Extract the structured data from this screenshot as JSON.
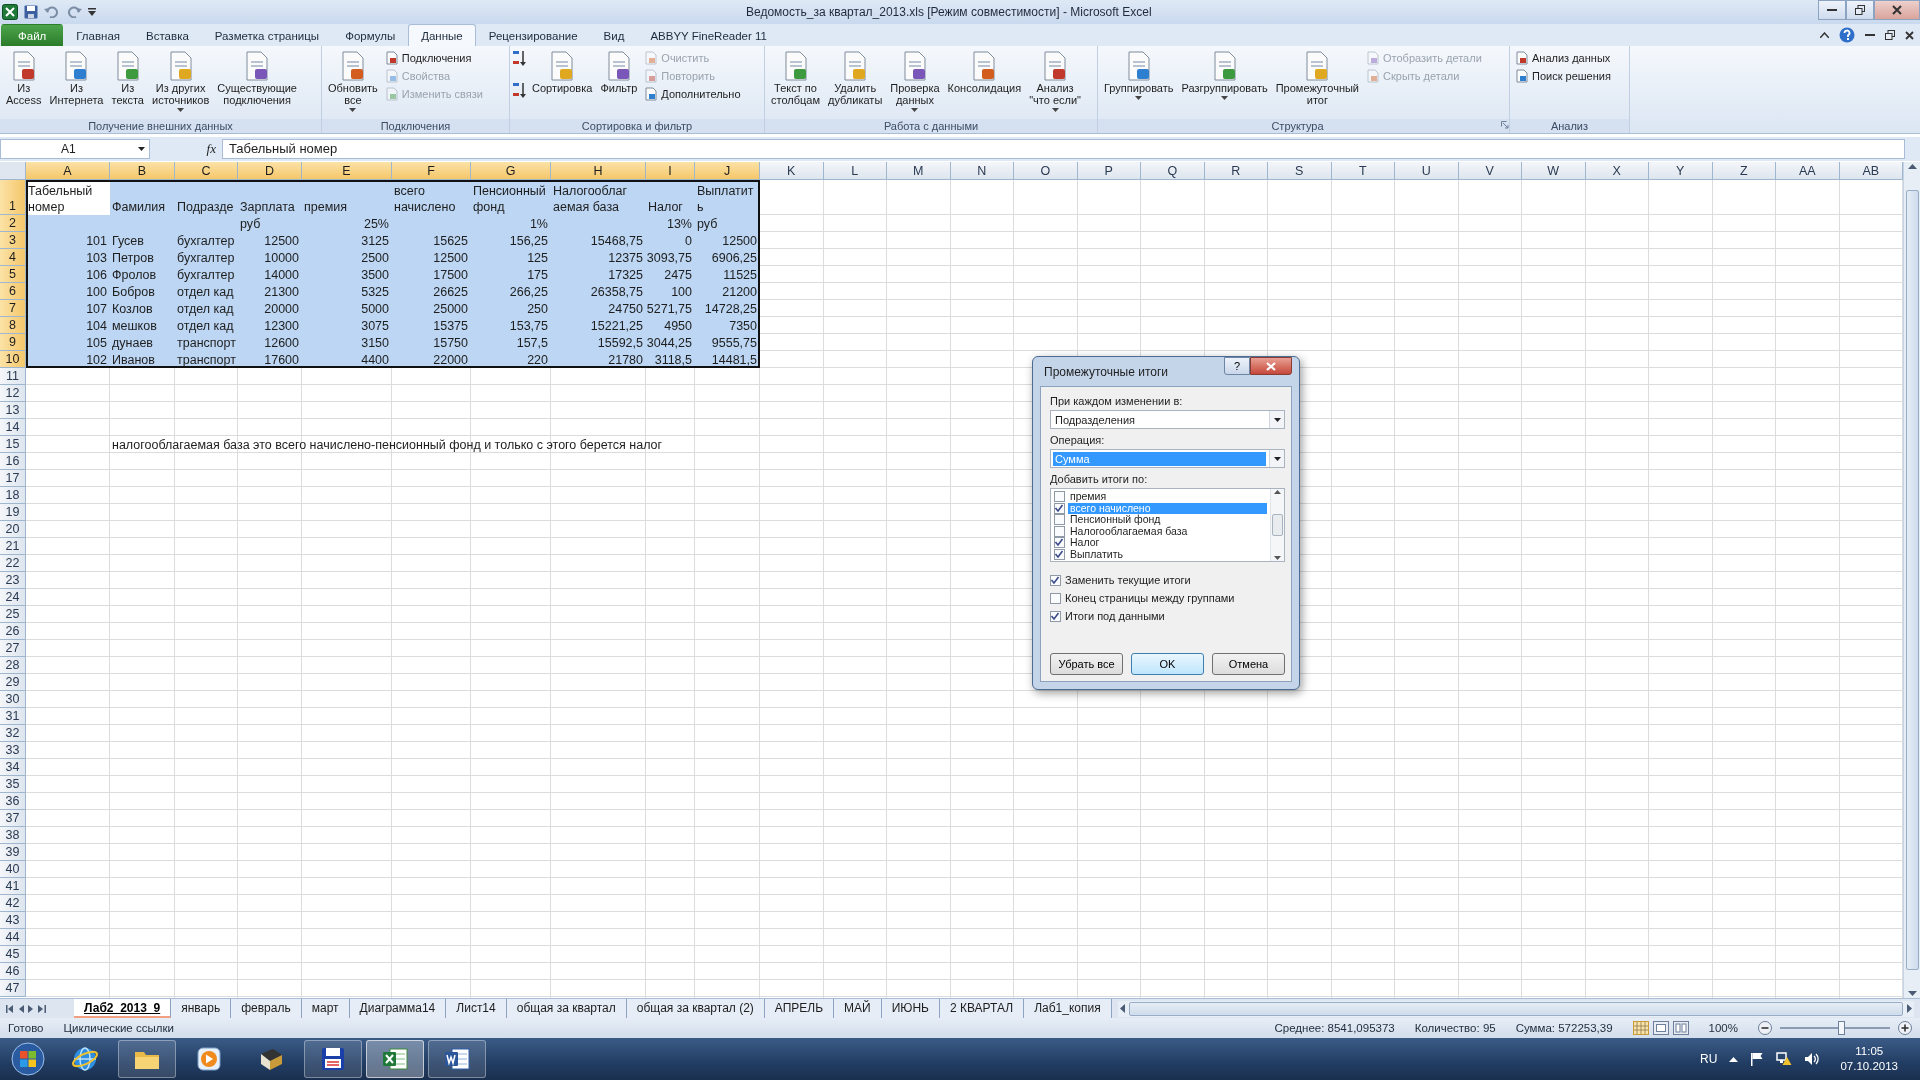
{
  "window": {
    "title": "Ведомость_за квартал_2013.xls  [Режим совместимости]  -  Microsoft Excel"
  },
  "ribbon_tabs": [
    {
      "label": "Файл",
      "kind": "file",
      "selected": false
    },
    {
      "label": "Главная",
      "kind": "tab",
      "selected": false
    },
    {
      "label": "Вставка",
      "kind": "tab",
      "selected": false
    },
    {
      "label": "Разметка страницы",
      "kind": "tab",
      "selected": false
    },
    {
      "label": "Формулы",
      "kind": "tab",
      "selected": false
    },
    {
      "label": "Данные",
      "kind": "tab",
      "selected": true
    },
    {
      "label": "Рецензирование",
      "kind": "tab",
      "selected": false
    },
    {
      "label": "Вид",
      "kind": "tab",
      "selected": false
    },
    {
      "label": "ABBYY FineReader 11",
      "kind": "tab",
      "selected": false
    }
  ],
  "ribbon_groups": [
    {
      "label": "Получение внешних данных",
      "launcher": false,
      "buttons": [
        {
          "kind": "large",
          "label": "Из\nAccess",
          "dropdown": false,
          "disabled": false
        },
        {
          "kind": "large",
          "label": "Из\nИнтернета",
          "dropdown": false,
          "disabled": false
        },
        {
          "kind": "large",
          "label": "Из\nтекста",
          "dropdown": false,
          "disabled": false
        },
        {
          "kind": "large",
          "label": "Из других\nисточников",
          "dropdown": true,
          "disabled": false
        },
        {
          "kind": "large",
          "label": "Существующие\nподключения",
          "dropdown": false,
          "disabled": false
        }
      ]
    },
    {
      "label": "Подключения",
      "launcher": false,
      "buttons": [
        {
          "kind": "large",
          "label": "Обновить\nвсе",
          "dropdown": true,
          "disabled": false
        },
        {
          "kind": "small",
          "label": "Подключения",
          "dropdown": false,
          "disabled": false
        },
        {
          "kind": "small",
          "label": "Свойства",
          "dropdown": false,
          "disabled": true
        },
        {
          "kind": "small",
          "label": "Изменить связи",
          "dropdown": false,
          "disabled": true
        }
      ]
    },
    {
      "label": "Сортировка и фильтр",
      "launcher": false,
      "buttons": [
        {
          "kind": "icon",
          "dropdown": false,
          "disabled": false
        },
        {
          "kind": "icon",
          "dropdown": false,
          "disabled": false
        },
        {
          "kind": "large",
          "label": "Сортировка",
          "dropdown": false,
          "disabled": false
        },
        {
          "kind": "large",
          "label": "Фильтр",
          "dropdown": false,
          "disabled": false
        },
        {
          "kind": "small",
          "label": "Очистить",
          "dropdown": false,
          "disabled": true
        },
        {
          "kind": "small",
          "label": "Повторить",
          "dropdown": false,
          "disabled": true
        },
        {
          "kind": "small",
          "label": "Дополнительно",
          "dropdown": false,
          "disabled": false
        }
      ]
    },
    {
      "label": "Работа с данными",
      "launcher": false,
      "buttons": [
        {
          "kind": "large",
          "label": "Текст по\nстолбцам",
          "dropdown": false,
          "disabled": false
        },
        {
          "kind": "large",
          "label": "Удалить\nдубликаты",
          "dropdown": false,
          "disabled": false
        },
        {
          "kind": "large",
          "label": "Проверка\nданных",
          "dropdown": true,
          "disabled": false
        },
        {
          "kind": "large",
          "label": "Консолидация",
          "dropdown": false,
          "disabled": false
        },
        {
          "kind": "large",
          "label": "Анализ\n\"что если\"",
          "dropdown": true,
          "disabled": false
        }
      ]
    },
    {
      "label": "Структура",
      "launcher": true,
      "buttons": [
        {
          "kind": "large",
          "label": "Группировать",
          "dropdown": true,
          "disabled": false
        },
        {
          "kind": "large",
          "label": "Разгруппировать",
          "dropdown": true,
          "disabled": false
        },
        {
          "kind": "large",
          "label": "Промежуточный\nитог",
          "dropdown": false,
          "disabled": false
        },
        {
          "kind": "small",
          "label": "Отобразить детали",
          "dropdown": false,
          "disabled": true
        },
        {
          "kind": "small",
          "label": "Скрыть детали",
          "dropdown": false,
          "disabled": true
        }
      ]
    },
    {
      "label": "Анализ",
      "launcher": false,
      "buttons": [
        {
          "kind": "small",
          "label": "Анализ данных",
          "dropdown": false,
          "disabled": false
        },
        {
          "kind": "small",
          "label": "Поиск решения",
          "dropdown": false,
          "disabled": false
        }
      ]
    }
  ],
  "formula_bar": {
    "name_box": "A1",
    "fx": "fx",
    "value": "Табельный номер"
  },
  "columns": [
    {
      "label": "A",
      "selected": true
    },
    {
      "label": "B",
      "selected": true
    },
    {
      "label": "C",
      "selected": true
    },
    {
      "label": "D",
      "selected": true
    },
    {
      "label": "E",
      "selected": true
    },
    {
      "label": "F",
      "selected": true
    },
    {
      "label": "G",
      "selected": true
    },
    {
      "label": "H",
      "selected": true
    },
    {
      "label": "I",
      "selected": true
    },
    {
      "label": "J",
      "selected": true
    },
    {
      "label": "K",
      "selected": false
    },
    {
      "label": "L",
      "selected": false
    },
    {
      "label": "M",
      "selected": false
    },
    {
      "label": "N",
      "selected": false
    },
    {
      "label": "O",
      "selected": false
    },
    {
      "label": "P",
      "selected": false
    },
    {
      "label": "Q",
      "selected": false
    },
    {
      "label": "R",
      "selected": false
    },
    {
      "label": "S",
      "selected": false
    },
    {
      "label": "T",
      "selected": false
    },
    {
      "label": "U",
      "selected": false
    },
    {
      "label": "V",
      "selected": false
    },
    {
      "label": "W",
      "selected": false
    },
    {
      "label": "X",
      "selected": false
    },
    {
      "label": "Y",
      "selected": false
    },
    {
      "label": "Z",
      "selected": false
    },
    {
      "label": "AA",
      "selected": false
    },
    {
      "label": "AB",
      "selected": false
    }
  ],
  "rows": [
    {
      "number": "1",
      "selected": true,
      "cells": [
        "Табельный номер",
        "Фамилия",
        "Подразде",
        "Зарплата",
        "премия",
        "всего начислено",
        "Пенсионный фонд",
        "Налогооблаг аемая база",
        "Налог",
        "Выплатить"
      ]
    },
    {
      "number": "2",
      "selected": true,
      "cells": [
        null,
        null,
        null,
        "руб",
        "25%",
        null,
        "1%",
        null,
        "13%",
        "руб"
      ]
    },
    {
      "number": "3",
      "selected": true,
      "cells": [
        "101",
        "Гусев",
        "бухгалтер",
        "12500",
        "3125",
        "15625",
        "156,25",
        "15468,75",
        "0",
        "12500"
      ]
    },
    {
      "number": "4",
      "selected": true,
      "cells": [
        "103",
        "Петров",
        "бухгалтер",
        "10000",
        "2500",
        "12500",
        "125",
        "12375",
        "3093,75",
        "6906,25"
      ]
    },
    {
      "number": "5",
      "selected": true,
      "cells": [
        "106",
        "Фролов",
        "бухгалтер",
        "14000",
        "3500",
        "17500",
        "175",
        "17325",
        "2475",
        "11525"
      ]
    },
    {
      "number": "6",
      "selected": true,
      "cells": [
        "100",
        "Бобров",
        "отдел кад",
        "21300",
        "5325",
        "26625",
        "266,25",
        "26358,75",
        "100",
        "21200"
      ]
    },
    {
      "number": "7",
      "selected": true,
      "cells": [
        "107",
        "Козлов",
        "отдел кад",
        "20000",
        "5000",
        "25000",
        "250",
        "24750",
        "5271,75",
        "14728,25"
      ]
    },
    {
      "number": "8",
      "selected": true,
      "cells": [
        "104",
        "мешков",
        "отдел кад",
        "12300",
        "3075",
        "15375",
        "153,75",
        "15221,25",
        "4950",
        "7350"
      ]
    },
    {
      "number": "9",
      "selected": true,
      "cells": [
        "105",
        "дунаев",
        "транспорт",
        "12600",
        "3150",
        "15750",
        "157,5",
        "15592,5",
        "3044,25",
        "9555,75"
      ]
    },
    {
      "number": "10",
      "selected": true,
      "cells": [
        "102",
        "Иванов",
        "транспорт",
        "17600",
        "4400",
        "22000",
        "220",
        "21780",
        "3118,5",
        "14481,5"
      ]
    },
    {
      "number": "11",
      "selected": false
    },
    {
      "number": "12",
      "selected": false
    },
    {
      "number": "13",
      "selected": false
    },
    {
      "number": "14",
      "selected": false
    },
    {
      "number": "15",
      "selected": false,
      "cells": [
        null,
        "налогооблагаемая база это всего начислено-пенсионный фонд и только с этого берется налог"
      ]
    },
    {
      "number": "16",
      "selected": false
    },
    {
      "number": "17",
      "selected": false
    },
    {
      "number": "18",
      "selected": false
    },
    {
      "number": "19",
      "selected": false
    },
    {
      "number": "20",
      "selected": false
    },
    {
      "number": "21",
      "selected": false
    },
    {
      "number": "22",
      "selected": false
    },
    {
      "number": "23",
      "selected": false
    },
    {
      "number": "24",
      "selected": false
    },
    {
      "number": "25",
      "selected": false
    },
    {
      "number": "26",
      "selected": false
    },
    {
      "number": "27",
      "selected": false
    },
    {
      "number": "28",
      "selected": false
    },
    {
      "number": "29",
      "selected": false
    },
    {
      "number": "30",
      "selected": false
    },
    {
      "number": "31",
      "selected": false
    },
    {
      "number": "32",
      "selected": false
    },
    {
      "number": "33",
      "selected": false
    },
    {
      "number": "34",
      "selected": false
    },
    {
      "number": "35",
      "selected": false
    },
    {
      "number": "36",
      "selected": false
    },
    {
      "number": "37",
      "selected": false
    },
    {
      "number": "38",
      "selected": false
    },
    {
      "number": "39",
      "selected": false
    },
    {
      "number": "40",
      "selected": false
    },
    {
      "number": "41",
      "selected": false
    },
    {
      "number": "42",
      "selected": false
    },
    {
      "number": "43",
      "selected": false
    },
    {
      "number": "44",
      "selected": false
    },
    {
      "number": "45",
      "selected": false
    },
    {
      "number": "46",
      "selected": false
    },
    {
      "number": "47",
      "selected": false
    }
  ],
  "dialog": {
    "title": "Промежуточные итоги",
    "help": "?",
    "group_by": {
      "label": "При каждом изменении в:",
      "value": "Подразделения",
      "focused": false
    },
    "operation": {
      "label": "Операция:",
      "value": "Сумма",
      "focused": true
    },
    "totals_label": "Добавить итоги по:",
    "totals": [
      {
        "label": "премия",
        "checked": false,
        "selected": false
      },
      {
        "label": "всего начислено",
        "checked": true,
        "selected": true
      },
      {
        "label": "Пенсионный фонд",
        "checked": false,
        "selected": false
      },
      {
        "label": "Налогооблагаемая база",
        "checked": false,
        "selected": false
      },
      {
        "label": "Налог",
        "checked": true,
        "selected": false
      },
      {
        "label": "Выплатить",
        "checked": true,
        "selected": false
      }
    ],
    "options": [
      {
        "label": "Заменить текущие итоги",
        "checked": true
      },
      {
        "label": "Конец страницы между группами",
        "checked": false
      },
      {
        "label": "Итоги под данными",
        "checked": true
      }
    ],
    "buttons": [
      {
        "label": "Убрать все",
        "default": false
      },
      {
        "label": "OK",
        "default": true
      },
      {
        "label": "Отмена",
        "default": false
      }
    ]
  },
  "sheet_tabs": [
    {
      "label": "Лаб2_2013_9",
      "selected": true
    },
    {
      "label": "январь",
      "selected": false
    },
    {
      "label": "февраль",
      "selected": false
    },
    {
      "label": "март",
      "selected": false
    },
    {
      "label": "Диаграмма14",
      "selected": false
    },
    {
      "label": "Лист14",
      "selected": false
    },
    {
      "label": "общая за квартал",
      "selected": false
    },
    {
      "label": "общая за квартал (2)",
      "selected": false
    },
    {
      "label": "АПРЕЛЬ",
      "selected": false
    },
    {
      "label": "МАЙ",
      "selected": false
    },
    {
      "label": "ИЮНЬ",
      "selected": false
    },
    {
      "label": "2 КВАРТАЛ",
      "selected": false
    },
    {
      "label": "Лаб1_копия",
      "selected": false
    }
  ],
  "status_bar": {
    "left": [
      "Готово",
      "Циклические ссылки"
    ],
    "stats": [
      "Среднее: 8541,095373",
      "Количество: 95",
      "Сумма: 572253,39"
    ],
    "zoom": {
      "label": "100%",
      "level": 0.55
    }
  },
  "taskbar": {
    "apps": [
      {
        "running": false,
        "selected": false
      },
      {
        "running": true,
        "selected": false
      },
      {
        "running": false,
        "selected": false
      },
      {
        "running": false,
        "selected": false
      },
      {
        "running": true,
        "selected": false
      },
      {
        "running": true,
        "selected": true
      },
      {
        "running": true,
        "selected": false
      }
    ],
    "language": "RU",
    "time": "11:05",
    "date": "07.10.2013"
  }
}
